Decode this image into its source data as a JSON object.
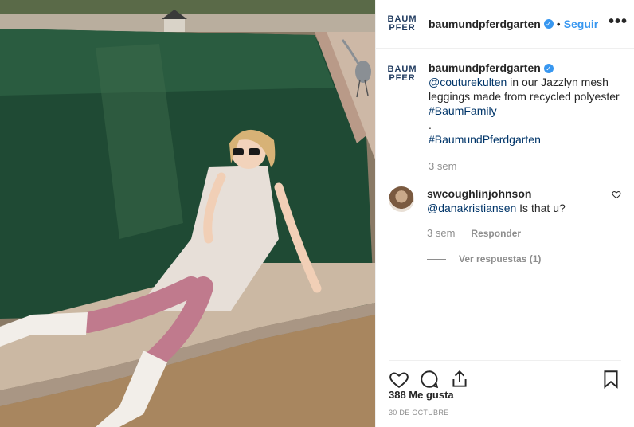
{
  "header": {
    "logo_text": "BAUM PFER",
    "username": "baumundpferdgarten",
    "separator": "•",
    "follow_label": "Seguir",
    "more_label": "•••"
  },
  "caption": {
    "username": "baumundpferdgarten",
    "mention": "@couturekulten",
    "text": " in our Jazzlyn mesh leggings made from recycled polyester ",
    "hashtag1": "#BaumFamily",
    "dot": ".",
    "hashtag2": "#BaumundPferdgarten",
    "time": "3 sem"
  },
  "comment": {
    "username": "swcoughlinjohnson",
    "mention": "@danakristiansen",
    "text": " Is that u?",
    "time": "3 sem",
    "reply_label": "Responder",
    "view_replies": "Ver respuestas (1)"
  },
  "footer": {
    "likes": "388 Me gusta",
    "date": "30 DE OCTUBRE"
  },
  "colors": {
    "accent": "#3897f0",
    "link": "#003569",
    "muted": "#8e8e8e"
  },
  "icons": {
    "like": "heart-icon",
    "comment": "comment-icon",
    "share": "share-icon",
    "save": "bookmark-icon",
    "more": "more-icon"
  }
}
